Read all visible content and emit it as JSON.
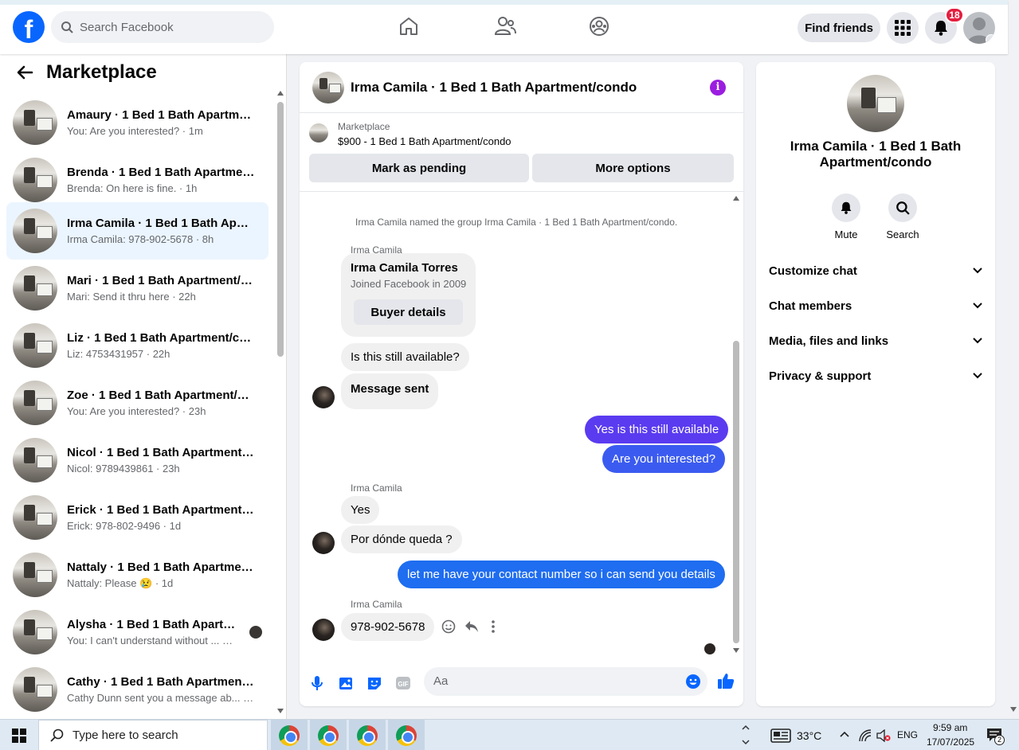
{
  "topbar": {
    "logo": "f",
    "search_placeholder": "Search Facebook",
    "find_friends": "Find friends",
    "notifications_count": "18"
  },
  "sidebar": {
    "title": "Marketplace",
    "conversations": [
      {
        "name": "Amaury · 1 Bed 1 Bath Apartmen...",
        "preview": "You: Are you interested? · 1m"
      },
      {
        "name": "Brenda · 1 Bed 1 Bath Apartment...",
        "preview": "Brenda: On here is fine. · 1h"
      },
      {
        "name": "Irma Camila · 1 Bed 1 Bath Apart...",
        "preview": "Irma Camila: 978-902-5678 · 8h"
      },
      {
        "name": "Mari · 1 Bed 1 Bath Apartment/c...",
        "preview": "Mari: Send it thru here · 22h"
      },
      {
        "name": "Liz · 1 Bed 1 Bath Apartment/con...",
        "preview": "Liz: 4753431957 · 22h"
      },
      {
        "name": "Zoe · 1 Bed 1 Bath Apartment/co...",
        "preview": "You: Are you interested? · 23h"
      },
      {
        "name": "Nicol · 1 Bed 1 Bath Apartment/c...",
        "preview": "Nicol: 9789439861 · 23h"
      },
      {
        "name": "Erick · 1 Bed 1 Bath Apartment/c...",
        "preview": "Erick: 978-802-9496 · 1d"
      },
      {
        "name": "Nattaly · 1 Bed 1 Bath Apartment...",
        "preview": "Nattaly: Please 😢 · 1d"
      },
      {
        "name": "Alysha · 1 Bed 1 Bath Apartme...",
        "preview": "You: I can't understand without ... · 1d"
      },
      {
        "name": "Cathy · 1 Bed 1 Bath Apartment/...",
        "preview": "Cathy Dunn sent you a message ab... · 1d"
      }
    ]
  },
  "chat": {
    "title": "Irma Camila · 1 Bed 1 Bath Apartment/condo",
    "marketplace_label": "Marketplace",
    "listing": "$900 - 1 Bed 1 Bath Apartment/condo",
    "mark_pending": "Mark as pending",
    "more_options": "More options",
    "system_message": "Irma Camila named the group Irma Camila · 1 Bed 1 Bath Apartment/condo.",
    "sender": "Irma Camila",
    "card_name": "Irma Camila Torres",
    "card_joined": "Joined Facebook in 2009",
    "card_button": "Buyer details",
    "messages": {
      "m1": "Is this still available?",
      "m2": "Message sent",
      "m3": "Yes is this still available",
      "m4": "Are you interested?",
      "m5": "Yes",
      "m6": "Por dónde queda ?",
      "m7": "let me have your contact number so i can send you details",
      "m8": "978-902-5678"
    },
    "composer_placeholder": "Aa"
  },
  "details": {
    "title": "Irma Camila · 1 Bed 1 Bath Apartment/condo",
    "mute": "Mute",
    "search": "Search",
    "rows": [
      "Customize chat",
      "Chat members",
      "Media, files and links",
      "Privacy & support"
    ]
  },
  "taskbar": {
    "search": "Type here to search",
    "temp": "33°C",
    "lang": "ENG",
    "time": "9:59 am",
    "date": "17/07/2025",
    "notif": "2"
  }
}
